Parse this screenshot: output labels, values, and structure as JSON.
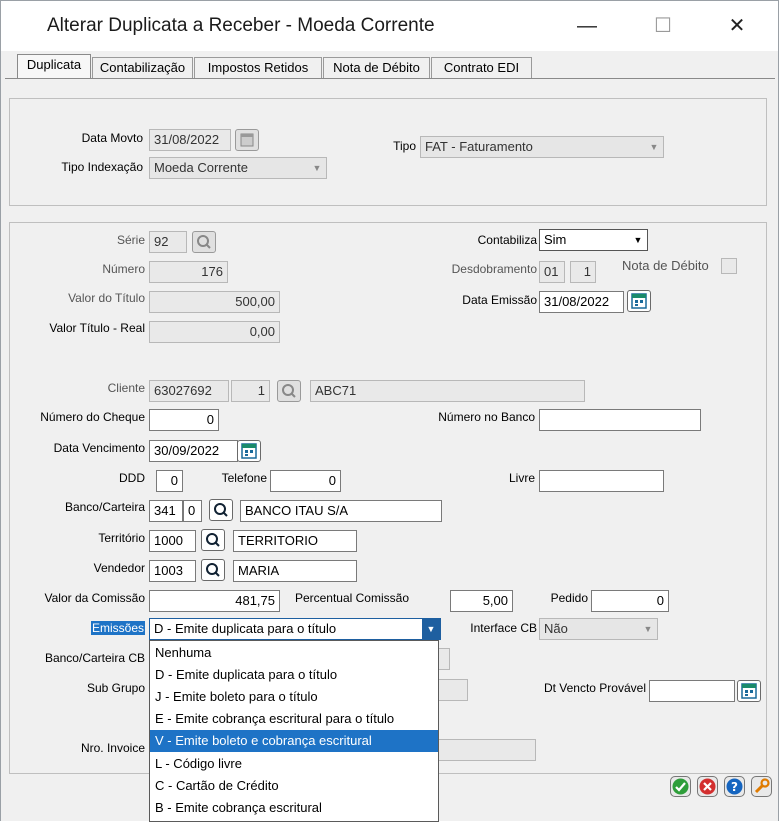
{
  "window": {
    "title": "Alterar Duplicata a Receber - Moeda Corrente",
    "min": "—",
    "max": "☐",
    "close": "✕"
  },
  "tabs": [
    "Duplicata",
    "Contabilização",
    "Impostos Retidos",
    "Nota de Débito",
    "Contrato EDI"
  ],
  "header": {
    "data_movto_label": "Data Movto",
    "data_movto": "31/08/2022",
    "tipo_indexacao_label": "Tipo Indexação",
    "tipo_indexacao": "Moeda Corrente",
    "tipo_label": "Tipo",
    "tipo": "FAT - Faturamento"
  },
  "form": {
    "serie_label": "Série",
    "serie": "92",
    "numero_label": "Número",
    "numero": "176",
    "valor_titulo_label": "Valor do Título",
    "valor_titulo": "500,00",
    "valor_titulo_real_label": "Valor Título - Real",
    "valor_titulo_real": "0,00",
    "contabiliza_label": "Contabiliza",
    "contabiliza": "Sim",
    "desdobramento_label": "Desdobramento",
    "desdobramento_a": "01",
    "desdobramento_b": "1",
    "nota_debito_label": "Nota de Débito",
    "data_emissao_label": "Data Emissão",
    "data_emissao": "31/08/2022",
    "cliente_label": "Cliente",
    "cliente_codigo": "63027692",
    "cliente_seq": "1",
    "cliente_nome": "ABC71",
    "numero_cheque_label": "Número do Cheque",
    "numero_cheque": "0",
    "numero_banco_label": "Número no Banco",
    "numero_banco": "",
    "data_vencimento_label": "Data Vencimento",
    "data_vencimento": "30/09/2022",
    "ddd_label": "DDD",
    "ddd": "0",
    "telefone_label": "Telefone",
    "telefone": "0",
    "livre_label": "Livre",
    "livre": "",
    "banco_carteira_label": "Banco/Carteira",
    "banco": "341",
    "carteira": "0",
    "banco_nome": "BANCO ITAU S/A",
    "territorio_label": "Território",
    "territorio_codigo": "1000",
    "territorio_nome": "TERRITORIO",
    "vendedor_label": "Vendedor",
    "vendedor_codigo": "1003",
    "vendedor_nome": "MARIA",
    "valor_comissao_label": "Valor da Comissão",
    "valor_comissao": "481,75",
    "percentual_comissao_label": "Percentual Comissão",
    "percentual_comissao": "5,00",
    "pedido_label": "Pedido",
    "pedido": "0",
    "emissoes_label": "Emissões",
    "emissoes": "D - Emite duplicata para o título",
    "interface_cb_label": "Interface CB",
    "interface_cb": "Não",
    "banco_carteira_cb_label": "Banco/Carteira CB",
    "sub_grupo_label": "Sub Grupo",
    "dt_vencto_provavel_label": "Dt Vencto Provável",
    "dt_vencto_provavel": "",
    "nro_invoice_label": "Nro. Invoice"
  },
  "emissoes_options": [
    "Nenhuma",
    "D - Emite duplicata para o título",
    "J  - Emite boleto para o título",
    "E - Emite cobrança escritural para o título",
    "V - Emite boleto e cobrança escritural",
    "L - Código livre",
    "C - Cartão de Crédito",
    "B - Emite cobrança escritural"
  ],
  "emissoes_highlighted_index": 4,
  "colors": {
    "highlight": "#1e73c6",
    "ok": "#2e9e3a",
    "cancel": "#d32f2f",
    "help": "#1565c0",
    "tool": "#e07b00"
  }
}
